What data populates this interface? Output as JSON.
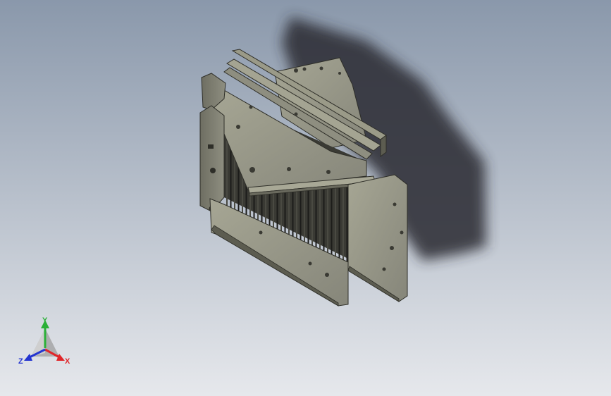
{
  "viewport": {
    "background_top": "#8a98ab",
    "background_bottom": "#e6e8ec"
  },
  "model": {
    "metal_face": "#8c8c7c",
    "metal_light": "#a6a694",
    "metal_dark": "#5c5c50",
    "metal_edge": "#2e2e28",
    "fin_color": "#1c1c1a",
    "shadow": "#2a2c31"
  },
  "triad": {
    "x_label": "X",
    "y_label": "Y",
    "z_label": "Z",
    "x_color": "#e0262a",
    "y_color": "#2bb038",
    "z_color": "#2435d0"
  }
}
